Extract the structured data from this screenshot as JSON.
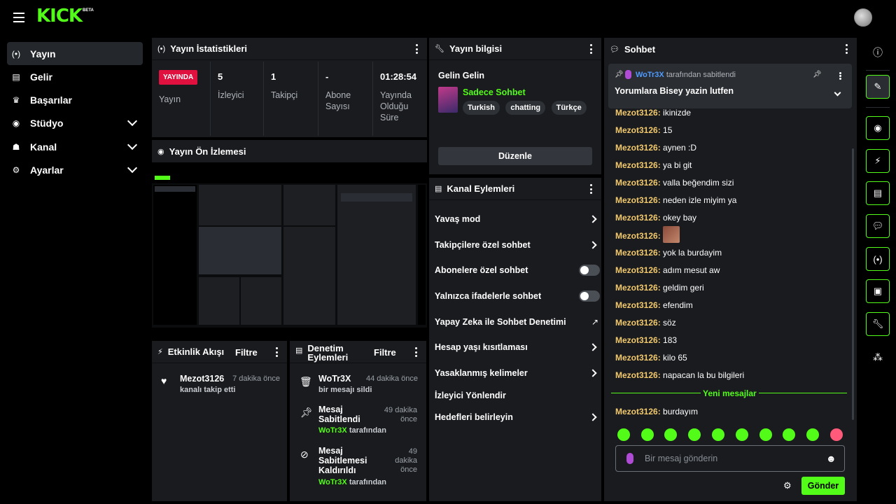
{
  "brand": {
    "logo": "KICK",
    "beta": "BETA",
    "accent": "#53fc18"
  },
  "sidebar": {
    "items": [
      {
        "label": "Yayın",
        "icon": "broadcast-icon"
      },
      {
        "label": "Gelir",
        "icon": "chart-icon"
      },
      {
        "label": "Başarılar",
        "icon": "trophy-icon"
      },
      {
        "label": "Stüdyo",
        "icon": "studio-icon"
      },
      {
        "label": "Kanal",
        "icon": "users-icon"
      },
      {
        "label": "Ayarlar",
        "icon": "gear-icon"
      }
    ]
  },
  "stats": {
    "title": "Yayın İstatistikleri",
    "live_badge": "YAYINDA",
    "stream_label": "Yayın",
    "viewers_value": "5",
    "viewers_label": "İzleyici",
    "followers_value": "1",
    "followers_label": "Takipçi",
    "subs_value": "-",
    "subs_label": "Abone Sayısı",
    "uptime_value": "01:28:54",
    "uptime_label": "Yayında Olduğu Süre"
  },
  "preview": {
    "title": "Yayın Ön İzlemesi"
  },
  "stream_info": {
    "title": "Yayın bilgisi",
    "stream_title": "Gelin Gelin",
    "category": "Sadece Sohbet",
    "tags": [
      "Turkish",
      "chatting",
      "Türkçe"
    ],
    "edit_label": "Düzenle"
  },
  "channel_actions": {
    "title": "Kanal Eylemleri",
    "items": [
      {
        "label": "Yavaş mod"
      },
      {
        "label": "Takipçilere özel sohbet"
      },
      {
        "label": "Abonelere özel sohbet"
      },
      {
        "label": "Yalnızca ifadelerle sohbet"
      },
      {
        "label": "Yapay Zeka ile Sohbet Denetimi"
      },
      {
        "label": "Hesap yaşı kısıtlaması"
      },
      {
        "label": "Yasaklanmış kelimeler"
      },
      {
        "label": "İzleyici Yönlendir"
      },
      {
        "label": "Hedefleri belirleyin"
      }
    ]
  },
  "activity": {
    "title": "Etkinlik Akışı",
    "filter": "Filtre",
    "items": [
      {
        "name": "Mezot3126",
        "time": "7 dakika önce",
        "sub": "kanalı takip etti"
      }
    ]
  },
  "mod_actions": {
    "title": "Denetim Eylemleri",
    "filter": "Filtre",
    "items": [
      {
        "name": "WoTr3X",
        "time": "44 dakika önce",
        "sub": "bir mesajı sildi"
      },
      {
        "name": "Mesaj Sabitlendi",
        "time": "49 dakika önce",
        "user": "WoTr3X",
        "sub": "tarafından"
      },
      {
        "name": "Mesaj Sabitlemesi Kaldırıldı",
        "time": "49 dakika önce",
        "user": "WoTr3X",
        "sub": "tarafından"
      }
    ]
  },
  "chat": {
    "title": "Sohbet",
    "pinned_by_user": "WoTr3X",
    "pinned_by_text": "tarafından sabitlendi",
    "pinned_message": "Yorumlara Bisey yazin lutfen",
    "messages": [
      {
        "user": "Mezot3126:",
        "text": "ikinizde"
      },
      {
        "user": "Mezot3126:",
        "text": "15"
      },
      {
        "user": "Mezot3126:",
        "text": "aynen :D"
      },
      {
        "user": "Mezot3126:",
        "text": "ya bi git"
      },
      {
        "user": "Mezot3126:",
        "text": "valla beğendim sizi"
      },
      {
        "user": "Mezot3126:",
        "text": "neden izle miyim ya"
      },
      {
        "user": "Mezot3126:",
        "text": "okey bay"
      },
      {
        "user": "Mezot3126:",
        "text": ""
      },
      {
        "user": "Mezot3126:",
        "text": "yok la burdayim"
      },
      {
        "user": "Mezot3126:",
        "text": "adım mesut aw"
      },
      {
        "user": "Mezot3126:",
        "text": "geldim geri"
      },
      {
        "user": "Mezot3126:",
        "text": "efendim"
      },
      {
        "user": "Mezot3126:",
        "text": "söz"
      },
      {
        "user": "Mezot3126:",
        "text": "183"
      },
      {
        "user": "Mezot3126:",
        "text": "kilo 65"
      },
      {
        "user": "Mezot3126:",
        "text": "napacan la bu bilgileri"
      }
    ],
    "new_messages_label": "Yeni mesajlar",
    "after_message": {
      "user": "Mezot3126:",
      "text": "burdayım"
    },
    "input_placeholder": "Bir mesaj gönderin",
    "send_label": "Gönder"
  }
}
